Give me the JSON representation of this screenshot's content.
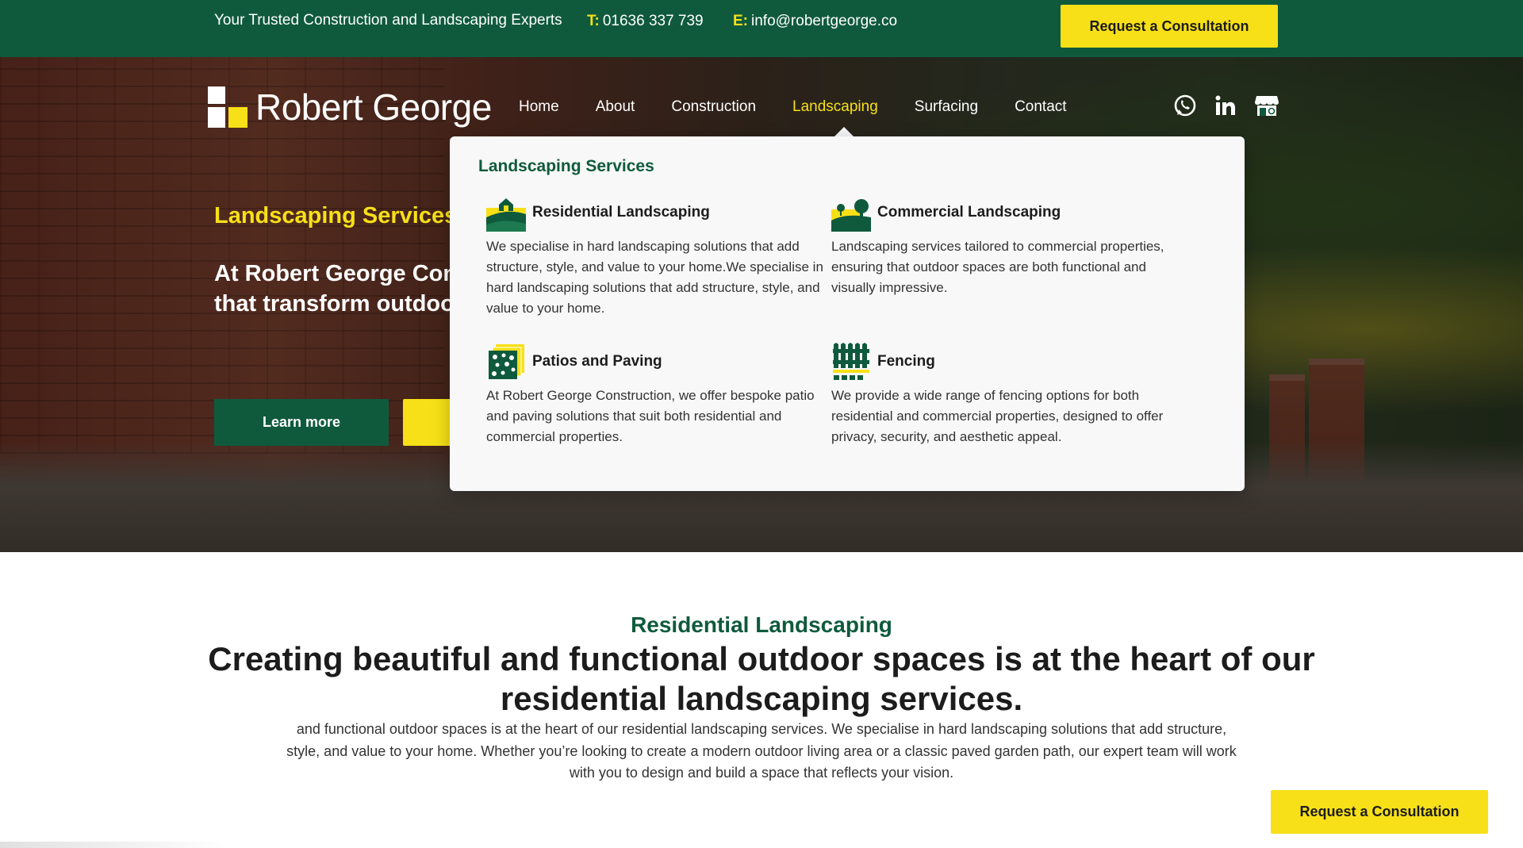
{
  "topbar": {
    "tagline": "Your Trusted Construction and Landscaping Experts",
    "phone_label": "T:",
    "phone": "01636 337 739",
    "email_label": "E:",
    "email": "info@robertgeorge.co",
    "cta": "Request a Consultation"
  },
  "brand": {
    "name": "Robert George"
  },
  "nav": {
    "items": [
      "Home",
      "About",
      "Construction",
      "Landscaping",
      "Surfacing",
      "Contact"
    ],
    "active": "Landscaping"
  },
  "social": [
    "whatsapp-icon",
    "linkedin-icon",
    "google-business-icon"
  ],
  "hero": {
    "subtitle": "Landscaping Services",
    "title": "At Robert George Cons delivering high-quality that transform outdoo and commercial client",
    "learn_more": "Learn more"
  },
  "dropdown": {
    "title": "Landscaping Services",
    "services": [
      {
        "name": "Residential Landscaping",
        "icon": "residential-landscape-icon",
        "desc": "We specialise in hard landscaping solutions that add structure, style, and value to your home.We specialise in hard landscaping solutions that add structure, style, and value to your home."
      },
      {
        "name": "Commercial Landscaping",
        "icon": "commercial-landscape-icon",
        "desc": "Landscaping services tailored to commercial properties, ensuring that outdoor spaces are both functional and visually impressive."
      },
      {
        "name": "Patios and Paving",
        "icon": "paving-icon",
        "desc": "At Robert George Construction, we offer bespoke patio and paving solutions that suit both residential and commercial properties."
      },
      {
        "name": "Fencing",
        "icon": "fence-icon",
        "desc": "We provide a wide range of fencing options for both residential and commercial properties, designed to offer privacy, security, and aesthetic appeal."
      }
    ]
  },
  "section": {
    "kicker": "Residential Landscaping",
    "title": "Creating beautiful and functional outdoor spaces is at the  heart of our residential landscaping services.",
    "body": "and functional outdoor spaces is at the heart of our residential landscaping services. We specialise in hard landscaping solutions that add structure, style, and value to your home. Whether you’re looking to create a modern outdoor living area or a classic paved garden path, our expert team will work with you to design and build a space that reflects your vision."
  },
  "float_cta": "Request a Consultation",
  "colors": {
    "brand_green": "#0f5a3d",
    "accent_yellow": "#f7e017"
  }
}
